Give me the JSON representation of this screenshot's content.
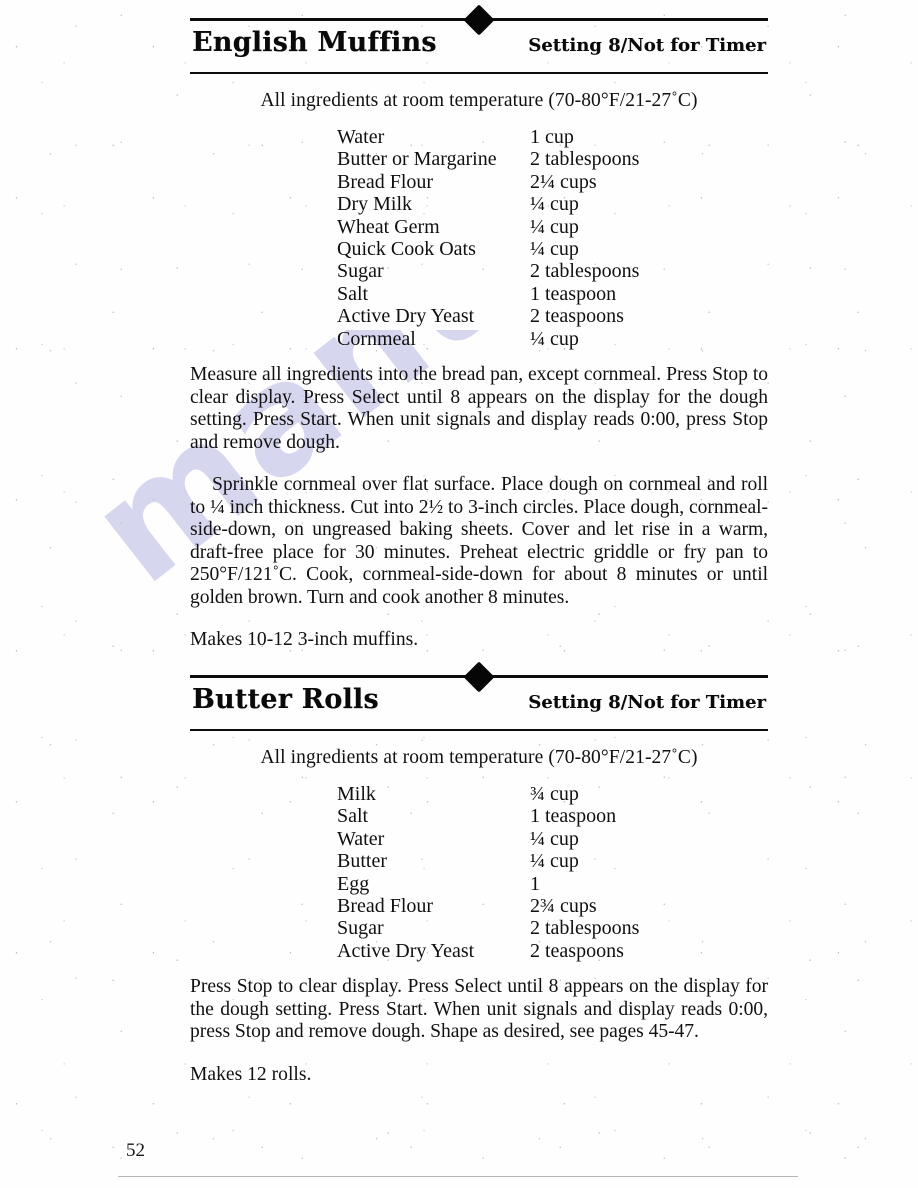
{
  "page": {
    "page_number": "52",
    "watermark_text": "manualslib.com"
  },
  "recipes": [
    {
      "title": "English Muffins",
      "setting": "Setting 8/Not for Timer",
      "temperature_note": "All ingredients at room temperature (70-80°F/21-27˚C)",
      "ingredients": [
        {
          "name": "Water",
          "amount": "1 cup"
        },
        {
          "name": "Butter or Margarine",
          "amount": "2 tablespoons"
        },
        {
          "name": "Bread Flour",
          "amount": "2¼ cups"
        },
        {
          "name": "Dry Milk",
          "amount": "¼ cup"
        },
        {
          "name": "Wheat Germ",
          "amount": "¼ cup"
        },
        {
          "name": "Quick Cook Oats",
          "amount": "¼ cup"
        },
        {
          "name": "Sugar",
          "amount": "2 tablespoons"
        },
        {
          "name": "Salt",
          "amount": "1 teaspoon"
        },
        {
          "name": "Active Dry Yeast",
          "amount": "2 teaspoons"
        },
        {
          "name": "Cornmeal",
          "amount": "¼ cup"
        }
      ],
      "paragraphs": [
        "Measure all ingredients into the bread pan, except cornmeal. Press Stop to clear display. Press Select until 8 appears on the display for the dough setting. Press Start. When unit signals and display reads 0:00, press Stop and remove dough.",
        "Sprinkle cornmeal over flat surface. Place dough on cornmeal and roll to ¼ inch thickness. Cut into 2½ to 3-inch circles. Place dough, cornmeal-side-down, on ungreased baking sheets. Cover and let rise in a warm, draft-free place for 30 minutes. Preheat electric griddle or fry pan to 250°F/121˚C. Cook, cornmeal-side-down for about 8 minutes or until golden brown. Turn and cook another 8 minutes."
      ],
      "makes": "Makes 10-12 3-inch muffins."
    },
    {
      "title": "Butter Rolls",
      "setting": "Setting 8/Not for Timer",
      "temperature_note": "All ingredients at room temperature (70-80°F/21-27˚C)",
      "ingredients": [
        {
          "name": "Milk",
          "amount": "¾ cup"
        },
        {
          "name": "Salt",
          "amount": "1 teaspoon"
        },
        {
          "name": "Water",
          "amount": "¼ cup"
        },
        {
          "name": "Butter",
          "amount": "¼ cup"
        },
        {
          "name": "Egg",
          "amount": "1"
        },
        {
          "name": "Bread Flour",
          "amount": "2¾ cups"
        },
        {
          "name": "Sugar",
          "amount": "2 tablespoons"
        },
        {
          "name": "Active Dry Yeast",
          "amount": "2 teaspoons"
        }
      ],
      "paragraphs": [
        "Press Stop to clear display. Press Select until 8 appears on the display for the dough setting. Press Start. When unit signals and display reads 0:00, press Stop and remove dough. Shape as desired, see pages 45-47."
      ],
      "makes": "Makes 12 rolls."
    }
  ]
}
